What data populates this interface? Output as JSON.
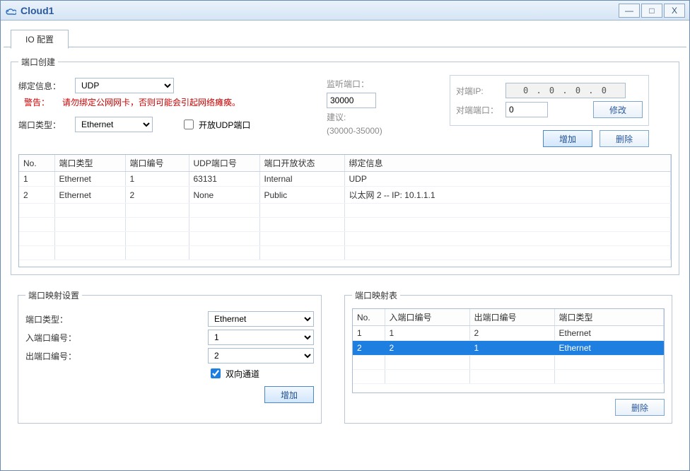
{
  "window": {
    "title": "Cloud1",
    "minimize": "—",
    "maximize": "□",
    "close": "X"
  },
  "tab": {
    "io_config": "IO 配置"
  },
  "port_create": {
    "legend": "端口创建",
    "bind_info_label": "绑定信息：",
    "bind_info_value": "UDP",
    "warn_label": "警告：",
    "warn_text": "请勿绑定公网网卡，否则可能会引起网络瘫痪。",
    "port_type_label": "端口类型：",
    "port_type_value": "Ethernet",
    "open_udp_label": "开放UDP端口",
    "listen_port_label": "监听端口：",
    "listen_port_value": "30000",
    "suggest_label": "建议:",
    "suggest_range": "(30000-35000)",
    "peer_ip_label": "对端IP:",
    "peer_ip_value": "0 . 0 . 0 . 0",
    "peer_port_label": "对端端口：",
    "peer_port_value": "0",
    "modify_btn": "修改",
    "add_btn": "增加",
    "delete_btn": "删除",
    "cols": {
      "no": "No.",
      "port_type": "端口类型",
      "port_no": "端口编号",
      "udp_port": "UDP端口号",
      "open_state": "端口开放状态",
      "bind_info": "绑定信息"
    },
    "rows": [
      {
        "no": "1",
        "type": "Ethernet",
        "pno": "1",
        "udp": "63131",
        "state": "Internal",
        "bind": "UDP"
      },
      {
        "no": "2",
        "type": "Ethernet",
        "pno": "2",
        "udp": "None",
        "state": "Public",
        "bind": "以太网 2 -- IP: 10.1.1.1"
      }
    ]
  },
  "map_set": {
    "legend": "端口映射设置",
    "port_type_label": "端口类型：",
    "port_type_value": "Ethernet",
    "in_port_label": "入端口编号：",
    "in_port_value": "1",
    "out_port_label": "出端口编号：",
    "out_port_value": "2",
    "bidir_label": "双向通道",
    "add_btn": "增加"
  },
  "map_table": {
    "legend": "端口映射表",
    "cols": {
      "no": "No.",
      "in": "入端口编号",
      "out": "出端口编号",
      "type": "端口类型"
    },
    "rows": [
      {
        "no": "1",
        "in": "1",
        "out": "2",
        "type": "Ethernet",
        "sel": false
      },
      {
        "no": "2",
        "in": "2",
        "out": "1",
        "type": "Ethernet",
        "sel": true
      }
    ],
    "delete_btn": "删除"
  }
}
